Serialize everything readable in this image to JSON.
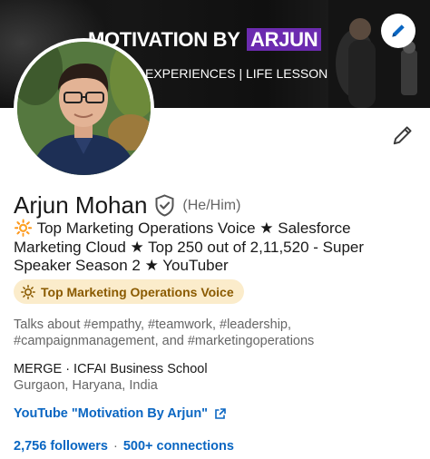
{
  "banner": {
    "title_main": "MOTIVATION BY",
    "title_highlight": "ARJUN",
    "subtitle": "EXPERIENCES | LIFE LESSONS"
  },
  "profile": {
    "name": "Arjun Mohan",
    "pronouns": "(He/Him)",
    "headline": "Top Marketing Operations Voice ★ Salesforce Marketing Cloud ★ Top 250 out of 2,11,520 - Super Speaker Season 2 ★ YouTuber",
    "headline_emoji": "🔆",
    "top_voice_badge": "Top Marketing Operations Voice",
    "talks_about": "Talks about #empathy, #teamwork, #leadership, #campaignmanagement, and #marketingoperations",
    "company_education": "MERGE · ICFAI Business School",
    "location": "Gurgaon, Haryana, India",
    "link_label": "YouTube \"Motivation By Arjun\"",
    "followers": "2,756 followers",
    "separator": "·",
    "connections": "500+ connections"
  },
  "colors": {
    "link_blue": "#0a66c2",
    "banner_highlight": "#6c2bb0",
    "badge_bg": "#fbeccb",
    "badge_text": "#8a5a00"
  },
  "icons": {
    "banner_edit": "pencil-icon",
    "profile_edit": "pencil-icon",
    "verified": "verified-shield-icon",
    "top_voice": "sun-icon",
    "external_link": "external-link-icon"
  }
}
